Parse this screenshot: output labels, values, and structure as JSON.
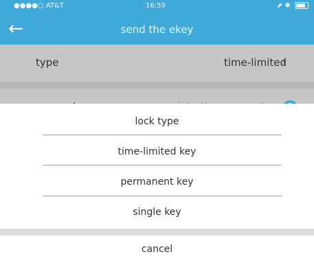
{
  "status_bar": {
    "carrier": "●●●●○ AT&T",
    "time": "16:59",
    "right": "⬈ ✱"
  },
  "header": {
    "back_icon": "arrow-left",
    "title": "send the ekey"
  },
  "form": {
    "type_label": "type",
    "type_value": "time-limited",
    "account_label": "account",
    "account_placeholder": "registration account"
  },
  "action_sheet": {
    "title": "lock type",
    "options": [
      "time-limited key",
      "permanent key",
      "single key"
    ],
    "cancel_label": "cancel"
  },
  "colors": {
    "accent": "#3fa9da",
    "overlay": "#c6c6c6"
  }
}
